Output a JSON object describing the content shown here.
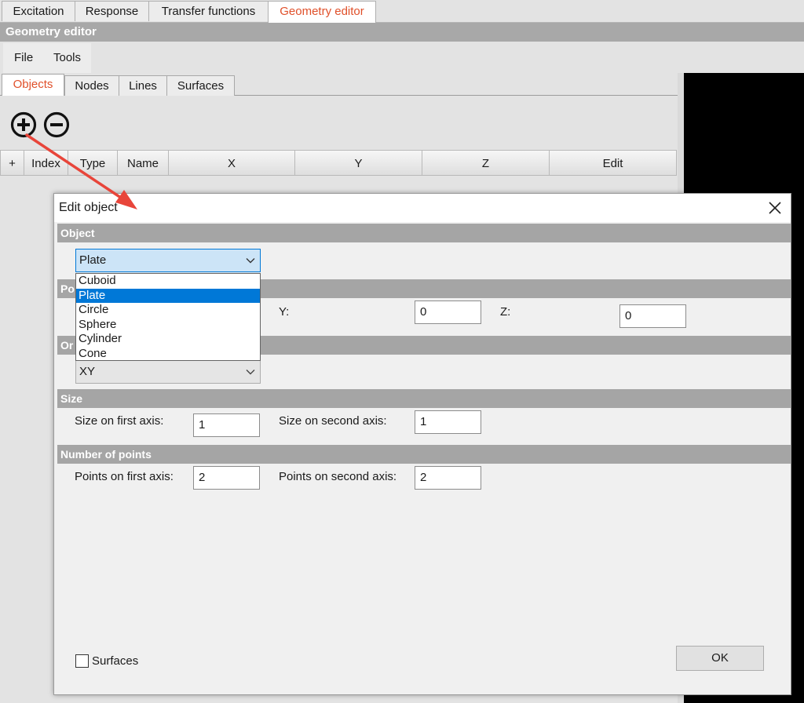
{
  "top_tabs": [
    "Excitation",
    "Response",
    "Transfer functions",
    "Geometry editor"
  ],
  "section_header": "Geometry editor",
  "menu": [
    "File",
    "Tools"
  ],
  "sub_tabs": [
    "Objects",
    "Nodes",
    "Lines",
    "Surfaces"
  ],
  "toolbar": {
    "add_icon": "plus-circle-icon",
    "remove_icon": "minus-circle-icon"
  },
  "grid_columns": [
    "+",
    "Index",
    "Type",
    "Name",
    "X",
    "Y",
    "Z",
    "Edit"
  ],
  "dialog": {
    "title": "Edit object",
    "groups": {
      "object": "Object",
      "position": "Po",
      "orientation": "Or",
      "size": "Size",
      "points": "Number of points"
    },
    "object_type": {
      "value": "Plate",
      "options": [
        "Cuboid",
        "Plate",
        "Circle",
        "Sphere",
        "Cylinder",
        "Cone"
      ],
      "selected_index": 1
    },
    "position": {
      "y_label": "Y:",
      "y_value": "0",
      "z_label": "Z:",
      "z_value": "0"
    },
    "orientation": {
      "value": "XY"
    },
    "size": {
      "first_label": "Size on first axis:",
      "first_value": "1",
      "second_label": "Size on second axis:",
      "second_value": "1"
    },
    "points": {
      "first_label": "Points on first axis:",
      "first_value": "2",
      "second_label": "Points on second axis:",
      "second_value": "2"
    },
    "surfaces_label": "Surfaces",
    "ok_label": "OK"
  },
  "colors": {
    "active_tab": "#e0502a",
    "selection": "#0078d7",
    "annotation_arrow": "#e8453a"
  }
}
